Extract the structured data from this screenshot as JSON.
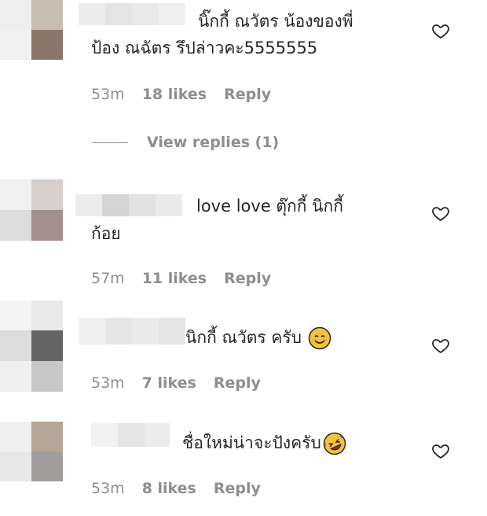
{
  "comments": [
    {
      "text_line1": "นิ๊กกี้ ณวัตร น้องของพี่",
      "text_line2": "ป้อง ณฉัตร รึปล่าวคะ5555555",
      "time": "53m",
      "likes": "18 likes",
      "reply": "Reply",
      "view_replies": "View replies (1)"
    },
    {
      "text_line1": "love love ตุ๊กกี้ นิกกี้",
      "text_line2": "ก้อย",
      "time": "57m",
      "likes": "11 likes",
      "reply": "Reply"
    },
    {
      "text_line1": "นิกกี้ ณวัตร ครับ",
      "emoji": "smiling-face-icon",
      "time": "53m",
      "likes": "7 likes",
      "reply": "Reply"
    },
    {
      "text_line1": "ชื่อใหม่น่าจะปังครับ",
      "emoji": "rolling-laughing-icon",
      "time": "53m",
      "likes": "8 likes",
      "reply": "Reply"
    }
  ],
  "colors": {
    "text": "#262626",
    "secondary": "#8e8e8e",
    "emoji_yellow": "#f7c23a"
  }
}
